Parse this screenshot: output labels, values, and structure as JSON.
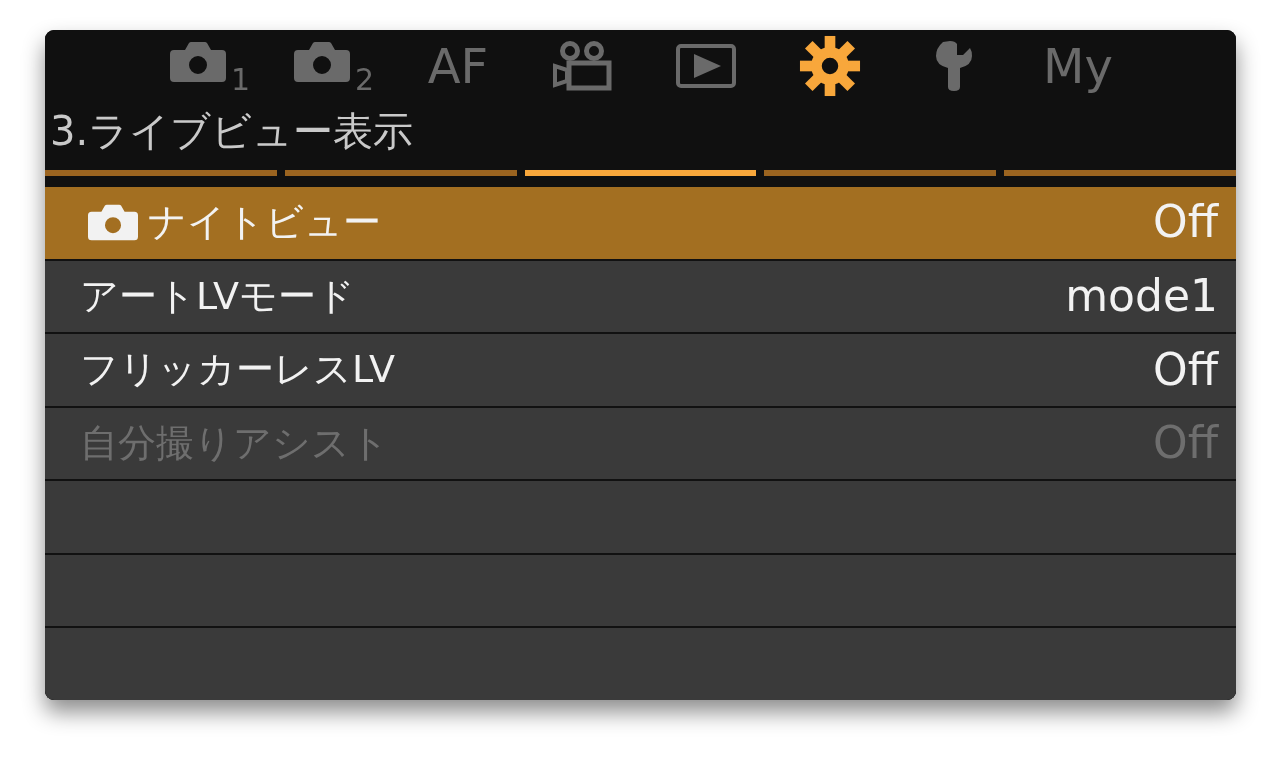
{
  "tabs": [
    {
      "kind": "camera",
      "label": "1",
      "selected": false
    },
    {
      "kind": "camera",
      "label": "2",
      "selected": false
    },
    {
      "kind": "text",
      "label": "AF",
      "selected": false
    },
    {
      "kind": "movie",
      "selected": false
    },
    {
      "kind": "playback",
      "selected": false
    },
    {
      "kind": "gear",
      "selected": true
    },
    {
      "kind": "wrench",
      "selected": false
    },
    {
      "kind": "text",
      "label": "My",
      "selected": false
    }
  ],
  "title": "3.ライブビュー表示",
  "pages": [
    {
      "selected": false
    },
    {
      "selected": false
    },
    {
      "selected": true
    },
    {
      "selected": false
    },
    {
      "selected": false
    }
  ],
  "rows": [
    {
      "kind": "photo",
      "label": "ナイトビュー",
      "value": "Off",
      "selected": true,
      "disabled": false
    },
    {
      "kind": "plain",
      "label": "アートLVモード",
      "value": "mode1",
      "selected": false,
      "disabled": false
    },
    {
      "kind": "plain",
      "label": "フリッカーレスLV",
      "value": "Off",
      "selected": false,
      "disabled": false
    },
    {
      "kind": "plain",
      "label": "自分撮りアシスト",
      "value": "Off",
      "selected": false,
      "disabled": true
    }
  ]
}
